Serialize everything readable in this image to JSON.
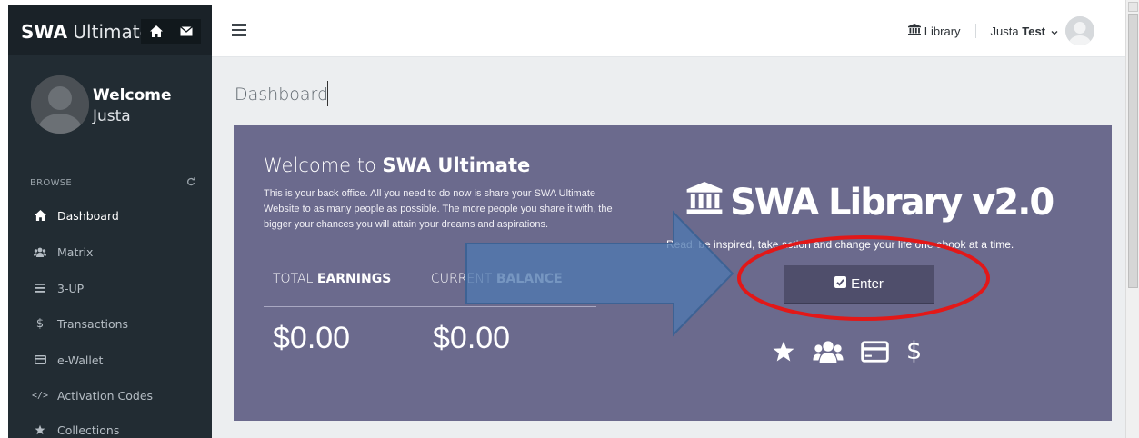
{
  "colors": {
    "sidebar_bg": "#222c33",
    "brand_bg": "#1a2228",
    "hero_bg": "#6b6a8d",
    "enter_button_bg": "#4f4e6b",
    "content_bg": "#eceef0",
    "annotation_arrow": "#4f79b0",
    "annotation_ellipse": "#e21818"
  },
  "brand": {
    "name_bold": "SWA",
    "name_light": " Ultimate",
    "home_icon": "home-icon",
    "mail_icon": "envelope-icon"
  },
  "user_panel": {
    "welcome": "Welcome",
    "name": "Justa"
  },
  "sidebar": {
    "section_label": "BROWSE",
    "items": [
      {
        "label": "Dashboard",
        "icon": "home-icon",
        "active": true
      },
      {
        "label": "Matrix",
        "icon": "users-icon",
        "active": false
      },
      {
        "label": "3-UP",
        "icon": "bars-icon",
        "active": false
      },
      {
        "label": "Transactions",
        "icon": "dollar-icon",
        "active": false
      },
      {
        "label": "e-Wallet",
        "icon": "credit-card-icon",
        "active": false
      },
      {
        "label": "Activation Codes",
        "icon": "code-icon",
        "active": false
      },
      {
        "label": "Collections",
        "icon": "star-icon",
        "active": false
      }
    ]
  },
  "topbar": {
    "library_label": "Library",
    "user_first": "Justa",
    "user_last": "Test"
  },
  "page": {
    "title": "Dashboard"
  },
  "hero": {
    "welcome_prefix": "Welcome to ",
    "welcome_brand": "SWA Ultimate",
    "description": "This is your back office. All you need to do now is share your SWA Ultimate Website to as many people as possible. The more people you share it with, the bigger your chances you will attain your dreams and aspirations.",
    "total_prefix": "TOTAL ",
    "total_bold": "EARNINGS",
    "balance_prefix": "CURRENT ",
    "balance_bold": "BALANCE",
    "total_value": "$0.00",
    "balance_value": "$0.00",
    "library_title": "SWA Library v2.0",
    "library_tagline": "Read, be inspired, take action and change your life one ebook at a time.",
    "enter_label": "Enter",
    "bottom_icons": [
      "star-icon",
      "users-icon",
      "credit-card-icon",
      "dollar-icon"
    ]
  }
}
